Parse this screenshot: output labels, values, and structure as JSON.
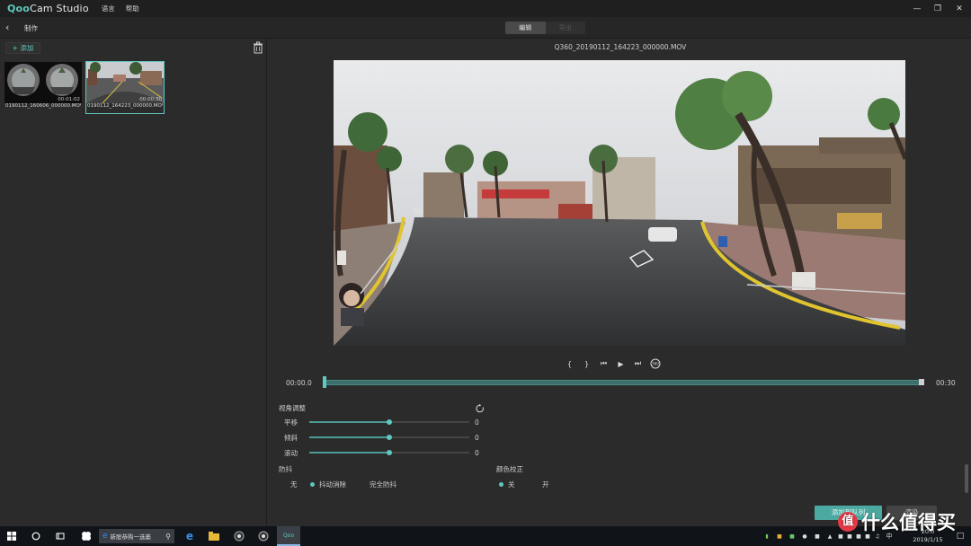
{
  "app": {
    "logo_prefix": "Qoo",
    "logo_rest": "Cam Studio",
    "menu": [
      "语言",
      "帮助"
    ]
  },
  "subbar": {
    "crumb": "制作",
    "tabs": [
      "编辑",
      "导出"
    ]
  },
  "library": {
    "add_label": "+ 添加",
    "clips": [
      {
        "name": "Q360_20190112_160606_000000.MOV",
        "display": "0190112_160606_000000.MOV",
        "duration": "00:01:02"
      },
      {
        "name": "Q360_20190112_164223_000000.MOV",
        "display": "0190112_164223_000000.MOV",
        "duration": "00:00:30"
      }
    ]
  },
  "player": {
    "filename": "Q360_20190112_164223_000000.MOV",
    "start_time": "00:00.0",
    "end_time": "00:30",
    "progress": 0.0,
    "controls": [
      "{",
      "}",
      "prev-frame",
      "play",
      "next-frame",
      "360"
    ]
  },
  "view_adjust": {
    "title": "视角调整",
    "sliders": [
      {
        "label": "平移",
        "value": "0",
        "position": 0.5
      },
      {
        "label": "倾斜",
        "value": "0",
        "position": 0.5
      },
      {
        "label": "滚动",
        "value": "0",
        "position": 0.5
      }
    ]
  },
  "stabilization": {
    "title": "防抖",
    "options": [
      {
        "label": "无",
        "selected": false
      },
      {
        "label": "抖动消除",
        "selected": true
      },
      {
        "label": "完全防抖",
        "selected": false
      }
    ]
  },
  "color_correction": {
    "title": "颜色校正",
    "options": [
      {
        "label": "关",
        "selected": true
      },
      {
        "label": "开",
        "selected": false
      }
    ]
  },
  "actions": {
    "primary": "添加到队列",
    "secondary": "渲染"
  },
  "taskbar": {
    "search_text": "新股恭购一选萎",
    "ime": "中",
    "time": "20:0",
    "date": "2019/1/15"
  },
  "watermark": {
    "badge": "值",
    "text": "什么值得买"
  },
  "colors": {
    "accent": "#5fc8c0",
    "bg": "#2b2b2b",
    "titlebar": "#1f1f1f"
  }
}
